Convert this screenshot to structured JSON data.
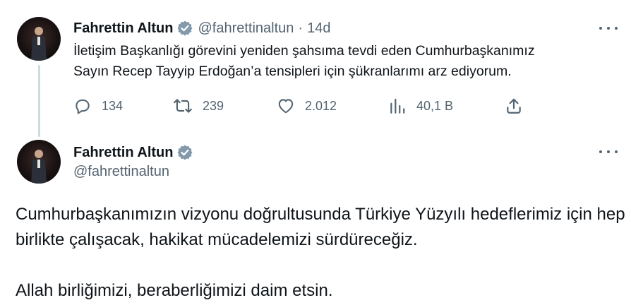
{
  "tweet1": {
    "author": {
      "name": "Fahrettin Altun",
      "handle": "@fahrettinaltun",
      "verified": true,
      "avatar": "avatar-photo"
    },
    "separator": "·",
    "time": "14d",
    "text": "İletişim Başkanlığı görevini yeniden şahsıma tevdi eden Cumhurbaşkanımız\nSayın Recep Tayyip Erdoğan’a tensipleri için şükranlarımı arz ediyorum.",
    "actions": {
      "replies": "134",
      "reposts": "239",
      "likes": "2.012",
      "views": "40,1 B"
    },
    "icons": [
      "reply-icon",
      "repost-icon",
      "like-icon",
      "views-icon",
      "share-icon",
      "more-icon"
    ]
  },
  "tweet2": {
    "author": {
      "name": "Fahrettin Altun",
      "handle": "@fahrettinaltun",
      "verified": true,
      "avatar": "avatar-photo"
    },
    "paragraphs": [
      "Cumhurbaşkanımızın vizyonu doğrultusunda Türkiye Yüzyılı hedeflerimiz için hep birlikte çalışacak, hakikat mücadelemizi sürdüreceğiz.",
      "Allah birliğimizi, beraberliğimizi daim etsin."
    ]
  },
  "colors": {
    "text": "#0f1419",
    "secondary": "#536471",
    "verified_badge": "#829aab",
    "thread_line": "#cfd9de"
  }
}
